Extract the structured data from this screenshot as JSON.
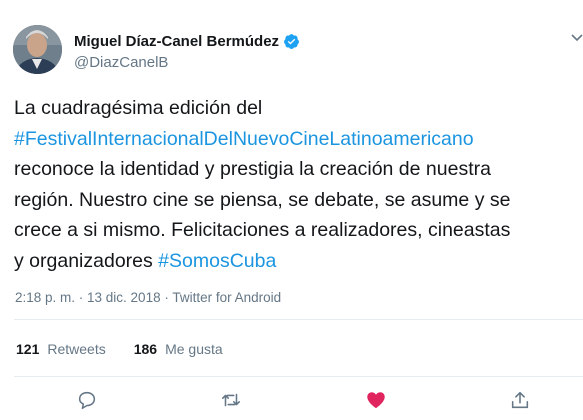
{
  "author": {
    "name": "Miguel Díaz-Canel Bermúdez",
    "handle": "@DiazCanelB",
    "verified": true
  },
  "tweet": {
    "lines": [
      [
        {
          "text": "La cuadragésima edición del",
          "hashtag": false
        }
      ],
      [
        {
          "text": "#FestivalInternacionalDelNuevoCineLatinoamericano",
          "hashtag": true
        }
      ],
      [
        {
          "text": "reconoce la identidad y prestigia la creación de nuestra",
          "hashtag": false
        }
      ],
      [
        {
          "text": "región. Nuestro cine se piensa, se debate, se asume y se",
          "hashtag": false
        }
      ],
      [
        {
          "text": "crece a si mismo. Felicitaciones a realizadores, cineastas",
          "hashtag": false
        }
      ],
      [
        {
          "text": "y organizadores ",
          "hashtag": false
        },
        {
          "text": "#SomosCuba",
          "hashtag": true
        }
      ]
    ],
    "meta": "2:18 p. m. · 13 dic. 2018 · Twitter for Android"
  },
  "stats": {
    "retweets_count": "121",
    "retweets_label": "Retweets",
    "likes_count": "186",
    "likes_label": "Me gusta"
  },
  "icons": {
    "reply": "reply-icon",
    "retweet": "retweet-icon",
    "like": "heart-icon",
    "share": "share-icon",
    "caret": "chevron-down-icon",
    "verified": "verified-badge-icon"
  },
  "colors": {
    "accent": "#1b95e0",
    "like": "#e0245e",
    "muted": "#657786"
  }
}
